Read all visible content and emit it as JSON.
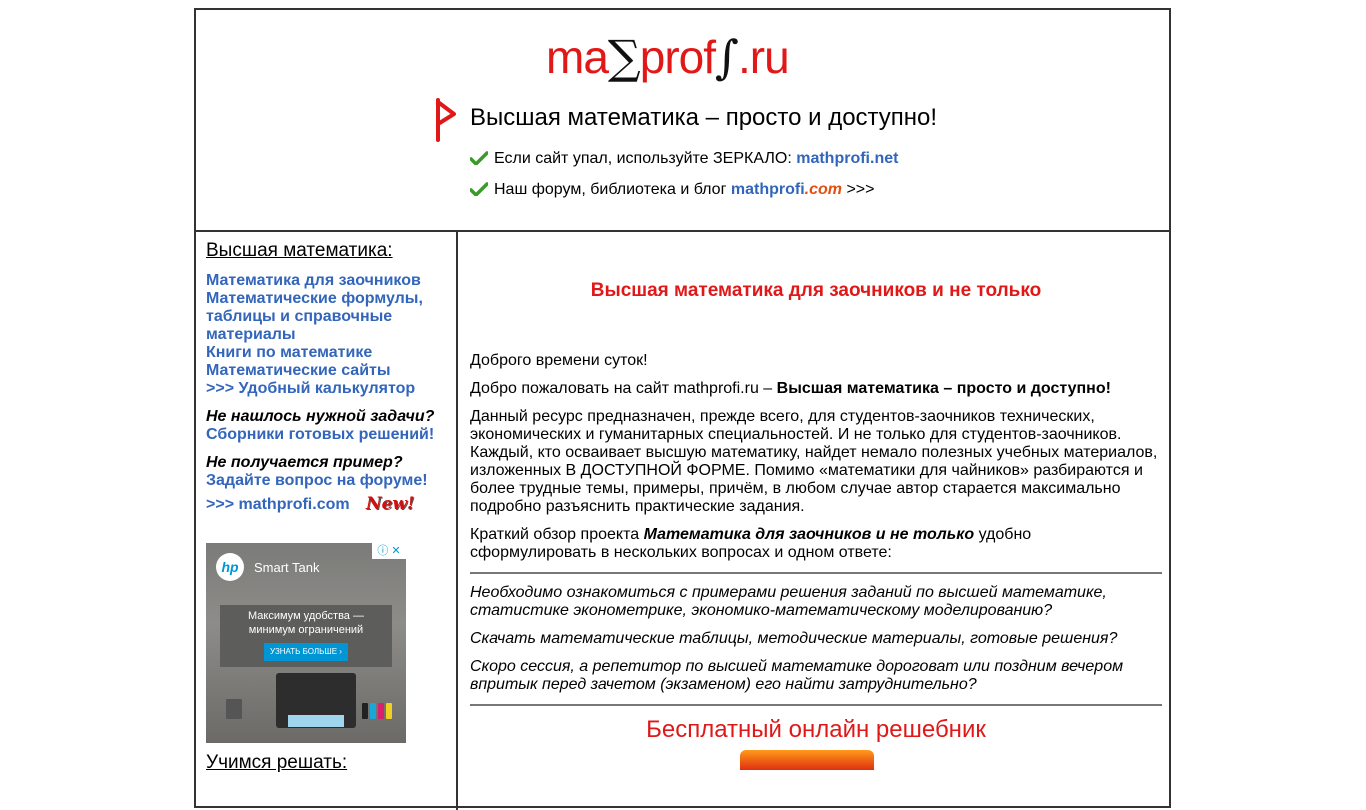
{
  "header": {
    "logo_text_1": "ma",
    "logo_symbol_sigma": "∑",
    "logo_text_2": "prof",
    "logo_symbol_integral": "∫",
    "logo_text_3": ".ru",
    "tagline": "Высшая математика – просто и доступно!",
    "mirror_text": "Если сайт упал, используйте ЗЕРКАЛО:",
    "mirror_link": "mathprofi.net",
    "forum_text": "Наш форум, библиотека и блог",
    "forum_link": "mathprofi",
    "forum_link_suffix": ".com",
    "forum_arrows": ">>>"
  },
  "sidebar": {
    "heading": "Высшая математика:",
    "links": [
      "Математика для заочников",
      "Математические формулы, таблицы и справочные материалы",
      "Книги по математике",
      "Математические сайты",
      ">>> Удобный калькулятор"
    ],
    "q1": "Не нашлось нужной задачи?",
    "q1_link": "Сборники готовых решений!",
    "q2": "Не получается пример?",
    "q2_link": "Задайте вопрос на форуме!",
    "forum_link": ">>> mathprofi.com",
    "new_badge": "New!",
    "heading2": "Учимся решать:"
  },
  "ad": {
    "brand": "Smart Tank",
    "logo": "hp",
    "close": "ⓘ ✕",
    "message_line1": "Максимум удобства —",
    "message_line2": "минимум ограничений",
    "cta": "УЗНАТЬ БОЛЬШЕ ›"
  },
  "main": {
    "title": "Высшая математика для заочников и не только",
    "greeting": "Доброго времени суток!",
    "welcome_prefix": "Добро пожаловать на сайт mathprofi.ru – ",
    "welcome_bold": "Высшая математика – просто и доступно!",
    "intro": "Данный ресурс предназначен, прежде всего, для студентов-заочников технических, экономических и гуманитарных специальностей. И не только для студентов-заочников. Каждый, кто осваивает высшую математику, найдет немало полезных учебных материалов, изложенных В ДОСТУПНОЙ ФОРМЕ. Помимо «математики для чайников» разбираются и более трудные темы, примеры, причём, в любом случае автор старается максимально подробно разъяснить практические задания.",
    "overview_prefix": "Краткий обзор проекта ",
    "overview_bold": "Математика для заочников и не только",
    "overview_suffix": " удобно сформулировать в нескольких вопросах и одном ответе:",
    "questions": [
      "Необходимо ознакомиться с  примерами решения заданий по высшей математике, статистике эконометрике, экономико-математическому моделированию?",
      "Скачать математические таблицы, методические материалы, готовые решения?",
      "Скоро сессия, а репетитор по высшей математике дороговат или поздним вечером впритык перед зачетом (экзаменом) его найти затруднительно?"
    ],
    "free_title": "Бесплатный онлайн решебник"
  },
  "colors": {
    "accent_red": "#e01818",
    "link_blue": "#3366bb",
    "border": "#333333"
  }
}
